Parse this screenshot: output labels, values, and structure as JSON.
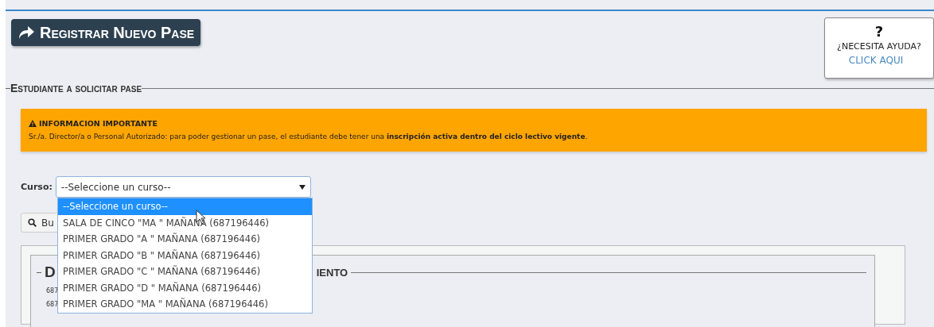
{
  "header": {
    "title": "Registrar Nuevo Pase"
  },
  "help": {
    "icon_text": "?",
    "label": "¿NECESITA AYUDA?",
    "link": "CLICK AQUI"
  },
  "section": {
    "legend": "Estudiante a solicitar pase"
  },
  "alert": {
    "title": "INFORMACION IMPORTANTE",
    "message": "Sr./a. Director/a o Personal Autorizado: para poder gestionar un pase, el estudiante debe tener una **inscripción activa dentro del ciclo lectivo vigente**."
  },
  "course": {
    "label": "Curso:",
    "value": "--Seleccione un curso--",
    "options": [
      {
        "label": "--Seleccione un curso--",
        "selected": true
      },
      {
        "label": "SALA DE CINCO \"MA \" MAÑANA (687196446)",
        "selected": false
      },
      {
        "label": "PRIMER GRADO \"A \" MAÑANA (687196446)",
        "selected": false
      },
      {
        "label": "PRIMER GRADO \"B \" MAÑANA (687196446)",
        "selected": false
      },
      {
        "label": "PRIMER GRADO \"C \" MAÑANA (687196446)",
        "selected": false
      },
      {
        "label": "PRIMER GRADO \"D \" MAÑANA (687196446)",
        "selected": false
      },
      {
        "label": "PRIMER GRADO \"MA \" MAÑANA (687196446)",
        "selected": false
      }
    ]
  },
  "search_button": {
    "label": "Bu"
  },
  "panel": {
    "legend_start": "D",
    "legend_end": "IENTO",
    "lines": [
      "687",
      "687"
    ]
  }
}
